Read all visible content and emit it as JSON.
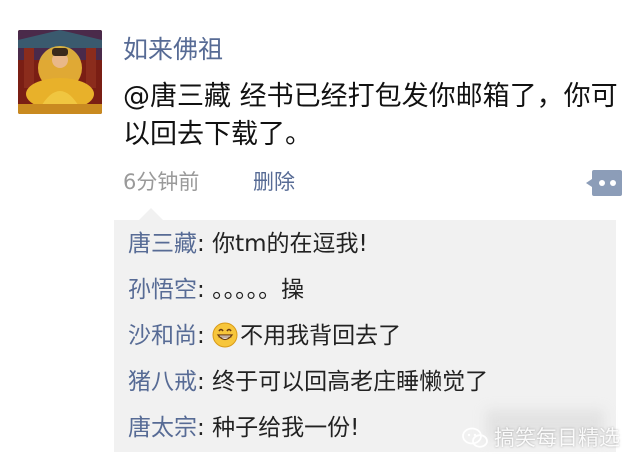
{
  "post": {
    "username": "如来佛祖",
    "text": "@唐三藏 经书已经打包发你邮箱了，你可以回去下载了。",
    "time": "6分钟前",
    "delete_label": "删除"
  },
  "comments": [
    {
      "name": "唐三藏",
      "sep": ": ",
      "text": "你tm的在逗我!"
    },
    {
      "name": "孙悟空",
      "sep": ": ",
      "text": "。。。。。操"
    },
    {
      "name": "沙和尚",
      "sep": ": ",
      "text": "不用我背回去了",
      "emoji": "grinning-face-icon"
    },
    {
      "name": "猪八戒",
      "sep": ": ",
      "text": "终于可以回高老庄睡懒觉了"
    },
    {
      "name": "唐太宗",
      "sep": ": ",
      "text": "种子给我一份!"
    }
  ],
  "watermark": {
    "text": "搞笑每日精选",
    "icon": "wechat-icon"
  },
  "colors": {
    "link": "#576b95",
    "comment_bg": "#f1f1f1",
    "meta": "#9a9a9a"
  }
}
